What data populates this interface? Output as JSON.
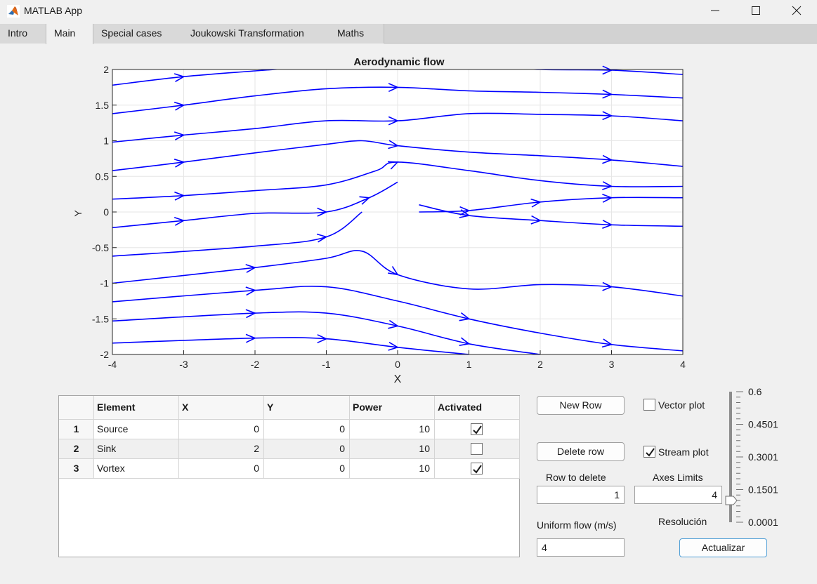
{
  "window": {
    "title": "MATLAB App",
    "icon": "matlab-icon"
  },
  "tabs": [
    {
      "label": "Intro"
    },
    {
      "label": "Main",
      "active": true
    },
    {
      "label": "Special cases"
    },
    {
      "label": "Joukowski Transformation"
    },
    {
      "label": "Maths"
    }
  ],
  "plot": {
    "title": "Aerodynamic flow",
    "xlabel": "X",
    "ylabel": "Y",
    "line_color": "#0000ff",
    "xticks": [
      "-4",
      "-3",
      "-2",
      "-1",
      "0",
      "1",
      "2",
      "3",
      "4"
    ],
    "yticks": [
      "2",
      "1.5",
      "1",
      "0.5",
      "0",
      "-0.5",
      "-1",
      "-1.5",
      "-2"
    ]
  },
  "chart_data": {
    "type": "line",
    "title": "Aerodynamic flow",
    "xlabel": "X",
    "ylabel": "Y",
    "xlim": [
      -4,
      4
    ],
    "ylim": [
      -2,
      2
    ],
    "grid": true,
    "description_of_marks": "streamlines with arrowheads",
    "series": [
      {
        "x": [
          -4,
          -3,
          -2,
          -1,
          0,
          1,
          2,
          3,
          4
        ],
        "y": [
          1.78,
          1.9,
          1.98,
          2.05,
          2.1,
          2.05,
          2.0,
          1.99,
          1.93
        ]
      },
      {
        "x": [
          -4,
          -3,
          -2,
          -1,
          0,
          1,
          2,
          3,
          4
        ],
        "y": [
          1.38,
          1.5,
          1.63,
          1.73,
          1.75,
          1.7,
          1.68,
          1.65,
          1.6
        ]
      },
      {
        "x": [
          -4,
          -3,
          -2,
          -1,
          0,
          1,
          2,
          3,
          4
        ],
        "y": [
          0.98,
          1.08,
          1.17,
          1.28,
          1.28,
          1.38,
          1.37,
          1.35,
          1.28
        ]
      },
      {
        "x": [
          -4,
          -3,
          -2,
          -1,
          -0.5,
          0,
          1,
          2,
          3,
          4
        ],
        "y": [
          0.58,
          0.7,
          0.83,
          0.95,
          1.0,
          0.93,
          0.84,
          0.79,
          0.73,
          0.64
        ]
      },
      {
        "x": [
          -4,
          -3,
          -2,
          -1,
          -0.3,
          0,
          1,
          2,
          3,
          4
        ],
        "y": [
          0.18,
          0.23,
          0.3,
          0.38,
          0.58,
          0.7,
          0.58,
          0.44,
          0.36,
          0.36
        ]
      },
      {
        "x": [
          -4,
          -3,
          -2,
          -1,
          -0.4,
          0
        ],
        "y": [
          -0.22,
          -0.12,
          -0.02,
          0.0,
          0.2,
          0.42
        ]
      },
      {
        "x": [
          -4,
          -2,
          -1,
          -0.5
        ],
        "y": [
          -0.62,
          -0.48,
          -0.35,
          0.0
        ]
      },
      {
        "x": [
          0.3,
          1,
          2,
          3,
          4
        ],
        "y": [
          0.0,
          0.02,
          0.14,
          0.2,
          0.2
        ]
      },
      {
        "x": [
          0.3,
          1,
          2,
          3,
          4
        ],
        "y": [
          0.1,
          -0.05,
          -0.12,
          -0.18,
          -0.2
        ]
      },
      {
        "x": [
          -4,
          -2,
          -1,
          -0.5,
          0,
          1,
          2,
          3,
          4
        ],
        "y": [
          -1.0,
          -0.78,
          -0.65,
          -0.55,
          -0.88,
          -1.08,
          -1.02,
          -1.05,
          -1.18
        ]
      },
      {
        "x": [
          -4,
          -2,
          -1,
          0,
          1,
          2,
          3,
          4
        ],
        "y": [
          -1.26,
          -1.1,
          -1.05,
          -1.25,
          -1.5,
          -1.7,
          -1.86,
          -1.95
        ]
      },
      {
        "x": [
          -4,
          -2,
          -1,
          0,
          1,
          2
        ],
        "y": [
          -1.53,
          -1.42,
          -1.42,
          -1.6,
          -1.85,
          -2.0
        ]
      },
      {
        "x": [
          -4,
          -2,
          -1,
          0,
          1
        ],
        "y": [
          -1.84,
          -1.77,
          -1.78,
          -1.9,
          -2.0
        ]
      }
    ]
  },
  "table": {
    "headers": [
      "",
      "Element",
      "X",
      "Y",
      "Power",
      "Activated"
    ],
    "rows": [
      {
        "num": "1",
        "element": "Source",
        "x": "0",
        "y": "0",
        "power": "10",
        "activated": true
      },
      {
        "num": "2",
        "element": "Sink",
        "x": "2",
        "y": "0",
        "power": "10",
        "activated": false
      },
      {
        "num": "3",
        "element": "Vortex",
        "x": "0",
        "y": "0",
        "power": "10",
        "activated": true
      }
    ]
  },
  "controls": {
    "new_row": "New Row",
    "delete_row": "Delete row",
    "row_to_delete_label": "Row to delete",
    "row_to_delete_value": "1",
    "axes_limits_label": "Axes Limits",
    "axes_limits_value": "4",
    "uniform_flow_label": "Uniform flow (m/s)",
    "uniform_flow_value": "4",
    "resolution_label": "Resolución",
    "update_button": "Actualizar",
    "vector_plot_label": "Vector plot",
    "vector_plot_checked": false,
    "stream_plot_label": "Stream plot",
    "stream_plot_checked": true
  },
  "slider": {
    "ticks": [
      "0.6",
      "0.4501",
      "0.3001",
      "0.1501",
      "0.0001"
    ],
    "min": 0.0001,
    "max": 0.6,
    "value": 0.1
  }
}
